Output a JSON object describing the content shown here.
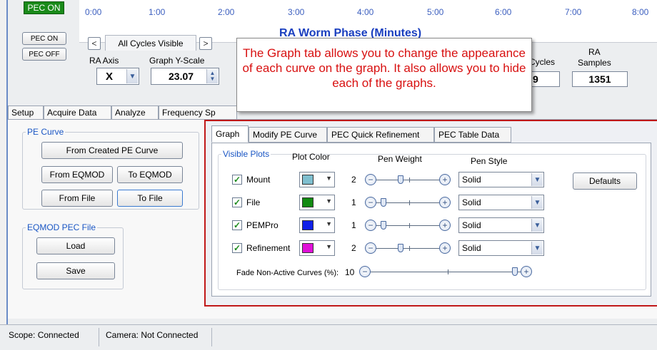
{
  "status": {
    "pec_state": "PEC ON"
  },
  "graph": {
    "time_labels": [
      "0:00",
      "1:00",
      "2:00",
      "3:00",
      "4:00",
      "5:00",
      "6:00",
      "7:00",
      "8:00"
    ],
    "title": "RA Worm Phase (Minutes)"
  },
  "controls": {
    "pec_on_button": "PEC ON",
    "pec_off_button": "PEC OFF",
    "cycles_tab": "All Cycles Visible",
    "prev_arrow": "<",
    "next_arrow": ">",
    "ra_axis_label": "RA Axis",
    "ra_axis_value": "X",
    "graph_yscale_label": "Graph Y-Scale",
    "graph_yscale_value": "23.07",
    "cycles_label": "Cycles",
    "cycles_value": "9",
    "ra_samples_label_1": "RA",
    "ra_samples_label_2": "Samples",
    "ra_samples_value": "1351"
  },
  "callout": {
    "text": "The Graph tab allows you to change the appearance of each curve on the graph.  It also allows you to hide each of the graphs."
  },
  "main_tabs": [
    "Setup",
    "Acquire Data",
    "Analyze",
    "Frequency Sp"
  ],
  "pe_curve": {
    "legend": "PE Curve",
    "from_created": "From Created PE Curve",
    "from_eqmod": "From EQMOD",
    "to_eqmod": "To EQMOD",
    "from_file": "From File",
    "to_file": "To File"
  },
  "eqmod_pec": {
    "legend": "EQMOD PEC File",
    "load": "Load",
    "save": "Save"
  },
  "inner_tabs": [
    "Graph",
    "Modify PE Curve",
    "PEC Quick Refinement",
    "PEC Table Data"
  ],
  "visible_plots": {
    "legend": "Visible Plots",
    "col_plot_color": "Plot Color",
    "col_pen_weight": "Pen Weight",
    "col_pen_style": "Pen Style",
    "defaults_button": "Defaults",
    "rows": [
      {
        "name": "Mount",
        "checked": true,
        "color": "#7fbfcf",
        "weight": "2",
        "weight_level": 0.4,
        "style": "Solid"
      },
      {
        "name": "File",
        "checked": true,
        "color": "#128a12",
        "weight": "1",
        "weight_level": 0.05,
        "style": "Solid"
      },
      {
        "name": "PEMPro",
        "checked": true,
        "color": "#1020e8",
        "weight": "1",
        "weight_level": 0.05,
        "style": "Solid"
      },
      {
        "name": "Refinement",
        "checked": true,
        "color": "#e010d8",
        "weight": "2",
        "weight_level": 0.4,
        "style": "Solid"
      }
    ],
    "fade_label": "Fade Non-Active Curves (%):",
    "fade_value": "10"
  },
  "statusbar": {
    "scope": "Scope: Connected",
    "camera": "Camera: Not Connected"
  }
}
